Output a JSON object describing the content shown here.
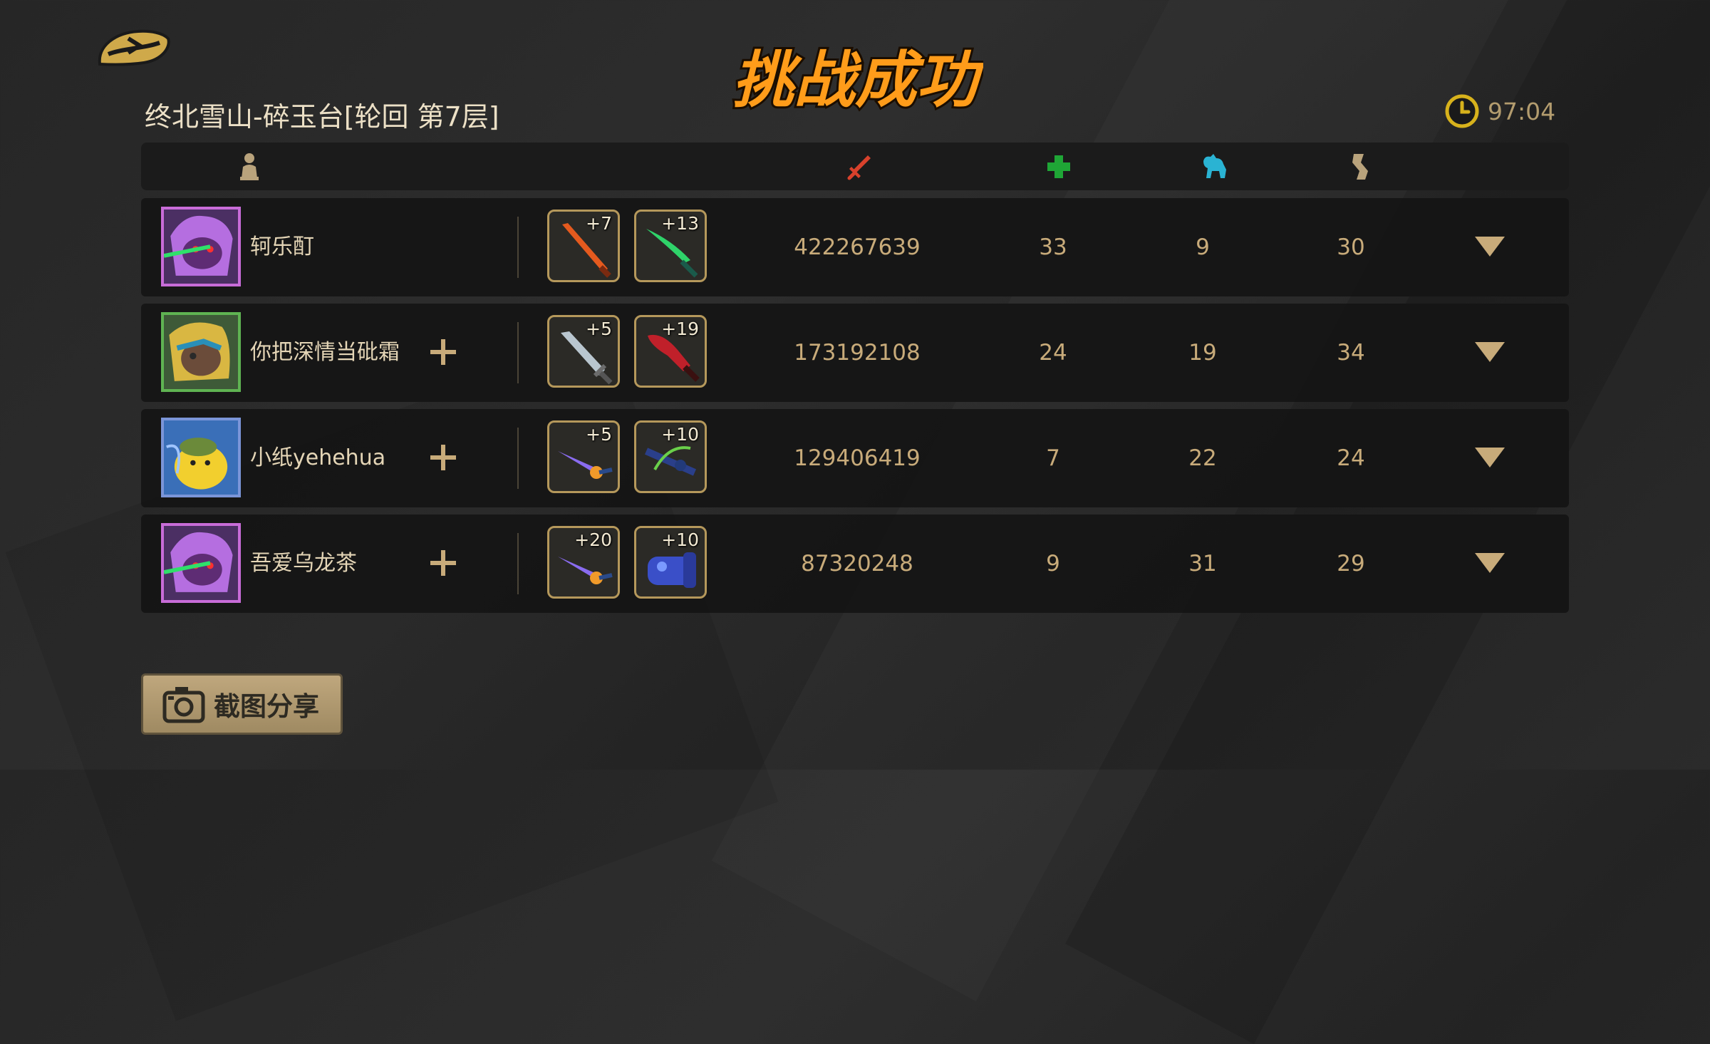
{
  "header": {
    "title_text": "挑战成功",
    "stage": "终北雪山-碎玉台[轮回  第7层]",
    "timer": "97:04"
  },
  "columns": {
    "icons": [
      "player-icon",
      "sword-icon",
      "heal-cross-icon",
      "pet-icon",
      "scroll-icon"
    ],
    "colors": {
      "sword": "#d8412c",
      "heal": "#1fa636",
      "pet": "#2ab3d3",
      "scroll": "#b9a37c"
    }
  },
  "players": [
    {
      "name": "轲乐酊",
      "weapon1_level": "+7",
      "weapon2_level": "+13",
      "damage": "422267639",
      "heal": "33",
      "pet": "9",
      "scroll": "30",
      "frame_color": "#c86cd8"
    },
    {
      "name": "你把深情当砒霜",
      "weapon1_level": "+5",
      "weapon2_level": "+19",
      "damage": "173192108",
      "heal": "24",
      "pet": "19",
      "scroll": "34",
      "frame_color": "#5fb352"
    },
    {
      "name": "小纸yehehua",
      "weapon1_level": "+5",
      "weapon2_level": "+10",
      "damage": "129406419",
      "heal": "7",
      "pet": "22",
      "scroll": "24",
      "frame_color": "#7b95d8"
    },
    {
      "name": "吾爱乌龙茶",
      "weapon1_level": "+20",
      "weapon2_level": "+10",
      "damage": "87320248",
      "heal": "9",
      "pet": "31",
      "scroll": "29",
      "frame_color": "#c86cd8"
    }
  ],
  "footer": {
    "share_label": "截图分享"
  }
}
